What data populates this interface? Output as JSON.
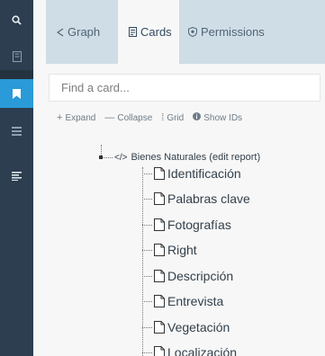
{
  "tabs": [
    {
      "label": "Graph",
      "icon": "share-icon"
    },
    {
      "label": "Cards",
      "icon": "card-icon"
    },
    {
      "label": "Permissions",
      "icon": "shield-icon"
    }
  ],
  "search": {
    "placeholder": "Find a card..."
  },
  "toolbar": {
    "expand": "Expand",
    "collapse": "Collapse",
    "grid": "Grid",
    "show_ids": "Show IDs"
  },
  "tree": {
    "root": "Bienes Naturales (edit report)",
    "cards": [
      "Identificación",
      "Palabras clave",
      "Fotografías",
      "Right",
      "Descripción",
      "Entrevista",
      "Vegetación",
      "Localización"
    ]
  },
  "colors": {
    "rail": "#2c3e50",
    "rail_active": "#2a9ad8",
    "tab_bar": "#cfdde6"
  }
}
